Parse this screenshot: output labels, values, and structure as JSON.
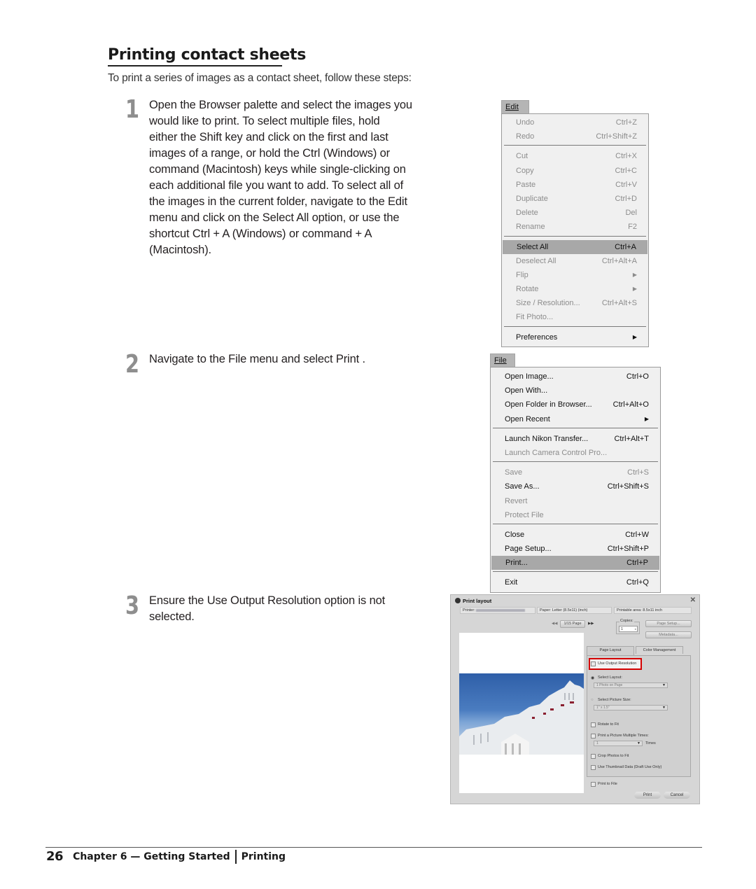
{
  "page": {
    "title": "Printing contact sheets",
    "intro": "To print a series of images as a contact sheet, follow these steps:"
  },
  "steps": [
    {
      "number": "1",
      "lines": [
        "Open the Browser palette and select the images you",
        "would like to print. To select multiple files, hold",
        "either the Shift key and click on the first and last",
        "images of a range, or hold the Ctrl (Windows) or",
        "command (Macintosh) keys while single-clicking on",
        "each additional file you want to add. To select all of",
        "the images in the current folder, navigate to the Edit",
        "menu and click on the Select All option, or use the",
        "shortcut Ctrl + A (Windows) or command + A",
        "(Macintosh)."
      ]
    },
    {
      "number": "2",
      "text": "Navigate to the File menu and select Print     ."
    },
    {
      "number": "3",
      "lines": [
        "Ensure the Use Output Resolution option is not",
        "selected."
      ]
    }
  ],
  "edit_menu": {
    "header": "Edit",
    "items": [
      {
        "label": "Undo",
        "shortcut": "Ctrl+Z",
        "state": "disabled"
      },
      {
        "label": "Redo",
        "shortcut": "Ctrl+Shift+Z",
        "state": "disabled"
      },
      {
        "sep": true
      },
      {
        "label": "Cut",
        "shortcut": "Ctrl+X",
        "state": "disabled"
      },
      {
        "label": "Copy",
        "shortcut": "Ctrl+C",
        "state": "disabled"
      },
      {
        "label": "Paste",
        "shortcut": "Ctrl+V",
        "state": "disabled"
      },
      {
        "label": "Duplicate",
        "shortcut": "Ctrl+D",
        "state": "disabled"
      },
      {
        "label": "Delete",
        "shortcut": "Del",
        "state": "disabled"
      },
      {
        "label": "Rename",
        "shortcut": "F2",
        "state": "disabled"
      },
      {
        "sep": true
      },
      {
        "label": "Select All",
        "shortcut": "Ctrl+A",
        "state": "selected"
      },
      {
        "label": "Deselect All",
        "shortcut": "Ctrl+Alt+A",
        "state": "disabled"
      },
      {
        "label": "Flip",
        "shortcut": "",
        "state": "disabled",
        "submenu": true
      },
      {
        "label": "Rotate",
        "shortcut": "",
        "state": "disabled",
        "submenu": true
      },
      {
        "label": "Size / Resolution...",
        "shortcut": "Ctrl+Alt+S",
        "state": "disabled"
      },
      {
        "label": "Fit Photo...",
        "shortcut": "",
        "state": "disabled"
      },
      {
        "sep": true
      },
      {
        "label": "Preferences",
        "shortcut": "",
        "state": "enabled",
        "submenu": true
      }
    ]
  },
  "file_menu": {
    "header": "File",
    "items": [
      {
        "label": "Open Image...",
        "shortcut": "Ctrl+O",
        "state": "enabled"
      },
      {
        "label": "Open With...",
        "shortcut": "",
        "state": "enabled"
      },
      {
        "label": "Open Folder in Browser...",
        "shortcut": "Ctrl+Alt+O",
        "state": "enabled"
      },
      {
        "label": "Open Recent",
        "shortcut": "",
        "state": "enabled",
        "submenu": true
      },
      {
        "sep": true
      },
      {
        "label": "Launch Nikon Transfer...",
        "shortcut": "Ctrl+Alt+T",
        "state": "enabled"
      },
      {
        "label": "Launch Camera Control Pro...",
        "shortcut": "",
        "state": "disabled"
      },
      {
        "sep": true
      },
      {
        "label": "Save",
        "shortcut": "Ctrl+S",
        "state": "disabled"
      },
      {
        "label": "Save As...",
        "shortcut": "Ctrl+Shift+S",
        "state": "enabled"
      },
      {
        "label": "Revert",
        "shortcut": "",
        "state": "disabled"
      },
      {
        "label": "Protect File",
        "shortcut": "",
        "state": "disabled"
      },
      {
        "sep": true
      },
      {
        "label": "Close",
        "shortcut": "Ctrl+W",
        "state": "enabled"
      },
      {
        "label": "Page Setup...",
        "shortcut": "Ctrl+Shift+P",
        "state": "enabled"
      },
      {
        "label": "Print...",
        "shortcut": "Ctrl+P",
        "state": "selected"
      },
      {
        "sep": true
      },
      {
        "label": "Exit",
        "shortcut": "Ctrl+Q",
        "state": "enabled"
      }
    ]
  },
  "print_dialog": {
    "title": "Print layout",
    "close_icon": "close-icon",
    "printer_label": "Printer:",
    "paper": "Paper:  Letter (8.5x11) (inch)",
    "printable_area": "Printable area:  8.5x11 inch",
    "page_indicator": "1/15 Page",
    "prev_icon": "rewind-icon",
    "next_icon": "fast-forward-icon",
    "copies_label": "Copies:",
    "copies_value": "1",
    "page_setup_button": "Page Setup...",
    "metadata_button": "Metadata...",
    "tabs": [
      "Page Layout",
      "Color Management"
    ],
    "use_output_resolution": "Use Output Resolution",
    "select_layout_label": "Select Layout:",
    "select_layout_value": "1 Photo on Page",
    "select_picture_size_label": "Select Picture Size:",
    "select_picture_size_value": "1\" x 1.5\"",
    "rotate_to_fit": "Rotate to Fit",
    "print_multiple": "Print a Picture Multiple Times:",
    "multiple_value": "1",
    "times_label": "Times",
    "crop_photos": "Crop Photos to Fit",
    "use_thumbnail": "Use Thumbnail Data (Draft Use Only)",
    "print_to_file": "Print to File",
    "print_button": "Print",
    "cancel_button": "Cancel",
    "highlight_color": "#d40000"
  },
  "footer": {
    "page_number": "26",
    "chapter": "Chapter 6 — Getting Started",
    "section": "Printing"
  }
}
